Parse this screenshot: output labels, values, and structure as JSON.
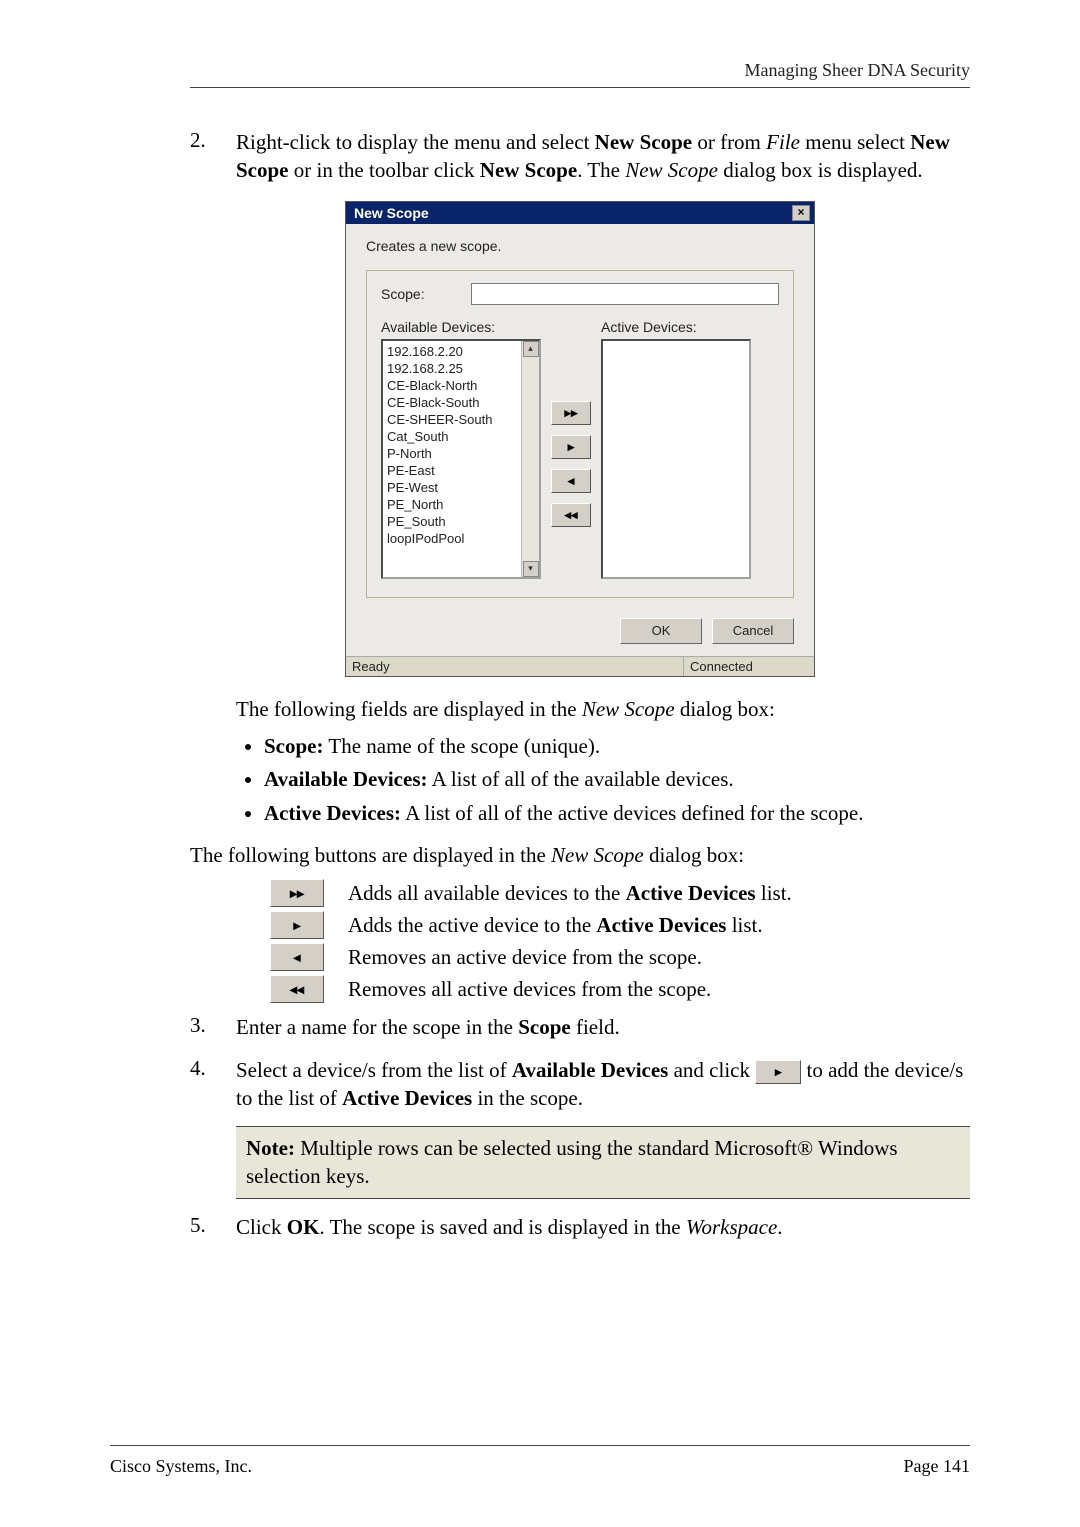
{
  "header": {
    "running_title": "Managing Sheer DNA Security"
  },
  "steps": {
    "s2_num": "2.",
    "s2_text_a": "Right-click to display the menu and select ",
    "s2_bold_a": "New Scope",
    "s2_text_b": " or from ",
    "s2_ital_a": "File",
    "s2_text_c": " menu select ",
    "s2_bold_b": "New Scope",
    "s2_text_d": " or in the toolbar click ",
    "s2_bold_c": "New Scope",
    "s2_text_e": ". The ",
    "s2_ital_b": "New Scope",
    "s2_text_f": " dialog box is displayed.",
    "s3_num": "3.",
    "s3_text_a": "Enter a name for the scope in the ",
    "s3_bold_a": "Scope",
    "s3_text_b": " field.",
    "s4_num": "4.",
    "s4_text_a": "Select a device/s from the list of ",
    "s4_bold_a": "Available Devices",
    "s4_text_b": " and click ",
    "s4_text_c": " to add the device/s to the list of ",
    "s4_bold_b": "Active Devices",
    "s4_text_d": " in the scope.",
    "s5_num": "5.",
    "s5_text_a": "Click ",
    "s5_bold_a": "OK",
    "s5_text_b": ". The scope is saved and is displayed in the ",
    "s5_ital_a": "Workspace",
    "s5_text_c": "."
  },
  "dialog": {
    "title": "New Scope",
    "close": "×",
    "desc": "Creates a new scope.",
    "scope_label": "Scope:",
    "avail_label": "Available Devices:",
    "active_label": "Active Devices:",
    "items": [
      "192.168.2.20",
      "192.168.2.25",
      "CE-Black-North",
      "CE-Black-South",
      "CE-SHEER-South",
      "Cat_South",
      "P-North",
      "PE-East",
      "PE-West",
      "PE_North",
      "PE_South",
      "loopIPodPool"
    ],
    "btn_all_right": "▸▸",
    "btn_right": "▸",
    "btn_left": "◂",
    "btn_all_left": "◂◂",
    "ok": "OK",
    "cancel": "Cancel",
    "status_ready": "Ready",
    "status_conn": "Connected",
    "scroll_up": "▴",
    "scroll_down": "▾"
  },
  "after_dialog": {
    "line1_a": "The following fields are displayed in the ",
    "line1_i": "New Scope",
    "line1_b": " dialog box:",
    "b1_bold": "Scope:",
    "b1_text": " The name of the scope (unique).",
    "b2_bold": "Available Devices:",
    "b2_text": " A list of all of the available devices.",
    "b3_bold": "Active Devices:",
    "b3_text": " A list of all of the active devices defined for the scope.",
    "line2_a": "The following buttons are displayed in the ",
    "line2_i": "New Scope",
    "line2_b": " dialog box:"
  },
  "btn_descs": {
    "d1_a": "Adds all available devices to the ",
    "d1_b": "Active Devices",
    "d1_c": " list.",
    "d2_a": "Adds the active device to the ",
    "d2_b": "Active Devices",
    "d2_c": " list.",
    "d3": "Removes an active device from the scope.",
    "d4": "Removes all active devices from the scope."
  },
  "note": {
    "bold": "Note:",
    "text": " Multiple rows can be selected using the standard Microsoft® Windows selection keys."
  },
  "footer": {
    "left": "Cisco Systems, Inc.",
    "right": "Page 141"
  },
  "glyphs": {
    "add_one": "▸"
  }
}
